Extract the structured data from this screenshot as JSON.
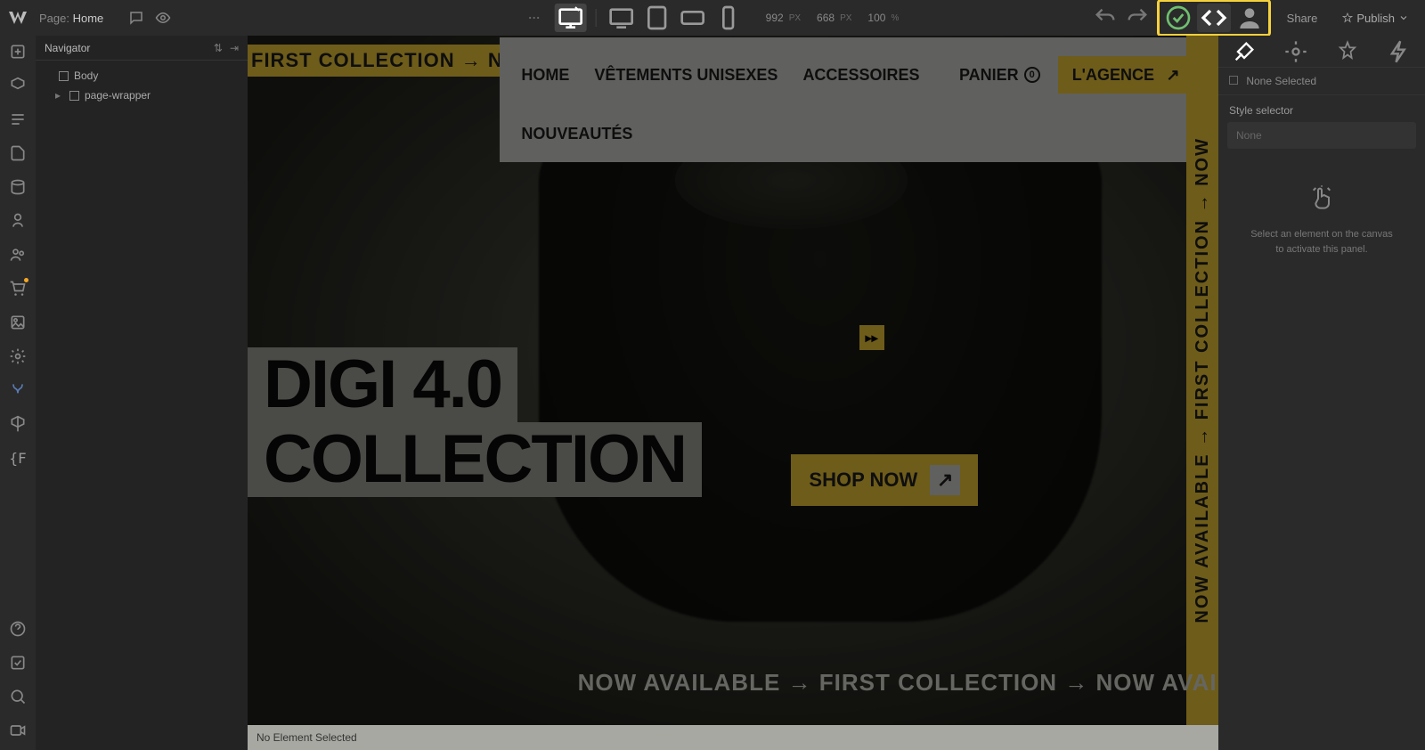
{
  "topbar": {
    "page_prefix": "Page:",
    "page_name": "Home",
    "width": "992",
    "height": "668",
    "px": "PX",
    "zoom": "100",
    "pct": "%",
    "share": "Share",
    "publish": "Publish",
    "tooltip": "Export code"
  },
  "navigator": {
    "title": "Navigator",
    "body": "Body",
    "wrapper": "page-wrapper"
  },
  "site": {
    "nav": {
      "home": "HOME",
      "vetements": "VÊTEMENTS UNISEXES",
      "accessoires": "ACCESSOIRES",
      "nouveautes": "NOUVEAUTÉS",
      "panier": "PANIER",
      "agence": "L'AGENCE"
    },
    "marquee_top": "FIRST COLLECTION → N",
    "hero_line1": "DIGI 4.0",
    "hero_line2": "COLLECTION",
    "shop_now": "SHOP NOW",
    "marquee_right": "NOW AVAILABLE → FIRST COLLECTION → NOW",
    "marquee_bottom": "NOW AVAILABLE → FIRST COLLECTION → NOW AVAILABLE"
  },
  "status": {
    "text": "No Element Selected"
  },
  "right_panel": {
    "selector_none": "None Selected",
    "style_selector": "Style selector",
    "none_placeholder": "None",
    "empty_line1": "Select an element on the canvas",
    "empty_line2": "to activate this panel."
  }
}
